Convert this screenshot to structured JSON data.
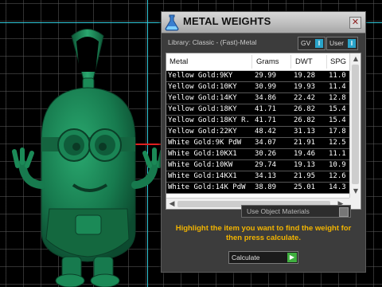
{
  "window": {
    "title": "METAL WEIGHTS",
    "close_icon": "close-icon"
  },
  "library": {
    "label": "Library: Classic - (Fast)-Metal"
  },
  "toggles": [
    {
      "label": "GV",
      "value": "I"
    },
    {
      "label": "User",
      "value": "I"
    }
  ],
  "table": {
    "columns": [
      "Metal",
      "Grams",
      "DWT",
      "SPG"
    ],
    "rows": [
      {
        "metal": "Yellow Gold:9KY",
        "grams": "29.99",
        "dwt": "19.28",
        "spg": "11.0"
      },
      {
        "metal": "Yellow Gold:10KY",
        "grams": "30.99",
        "dwt": "19.93",
        "spg": "11.4"
      },
      {
        "metal": "Yellow Gold:14KY",
        "grams": "34.86",
        "dwt": "22.42",
        "spg": "12.8"
      },
      {
        "metal": "Yellow Gold:18KY",
        "grams": "41.71",
        "dwt": "26.82",
        "spg": "15.4"
      },
      {
        "metal": "Yellow Gold:18KY R...",
        "grams": "41.71",
        "dwt": "26.82",
        "spg": "15.4"
      },
      {
        "metal": "Yellow Gold:22KY",
        "grams": "48.42",
        "dwt": "31.13",
        "spg": "17.8"
      },
      {
        "metal": "White Gold:9K PdW",
        "grams": "34.07",
        "dwt": "21.91",
        "spg": "12.5"
      },
      {
        "metal": "White Gold:10KX1",
        "grams": "30.26",
        "dwt": "19.46",
        "spg": "11.1"
      },
      {
        "metal": "White Gold:10KW",
        "grams": "29.74",
        "dwt": "19.13",
        "spg": "10.9"
      },
      {
        "metal": "White Gold:14KX1",
        "grams": "34.13",
        "dwt": "21.95",
        "spg": "12.6"
      },
      {
        "metal": "White Gold:14K PdW",
        "grams": "38.89",
        "dwt": "25.01",
        "spg": "14.3"
      }
    ]
  },
  "options": {
    "use_object_materials": "Use Object Materials"
  },
  "hint": "Highlight the item you want to find the weight for then press calculate.",
  "calculate": {
    "label": "Calculate"
  },
  "colors": {
    "model_green": "#177a4e",
    "hint_yellow": "#f2b400",
    "accent_blue": "#29a3c9"
  }
}
